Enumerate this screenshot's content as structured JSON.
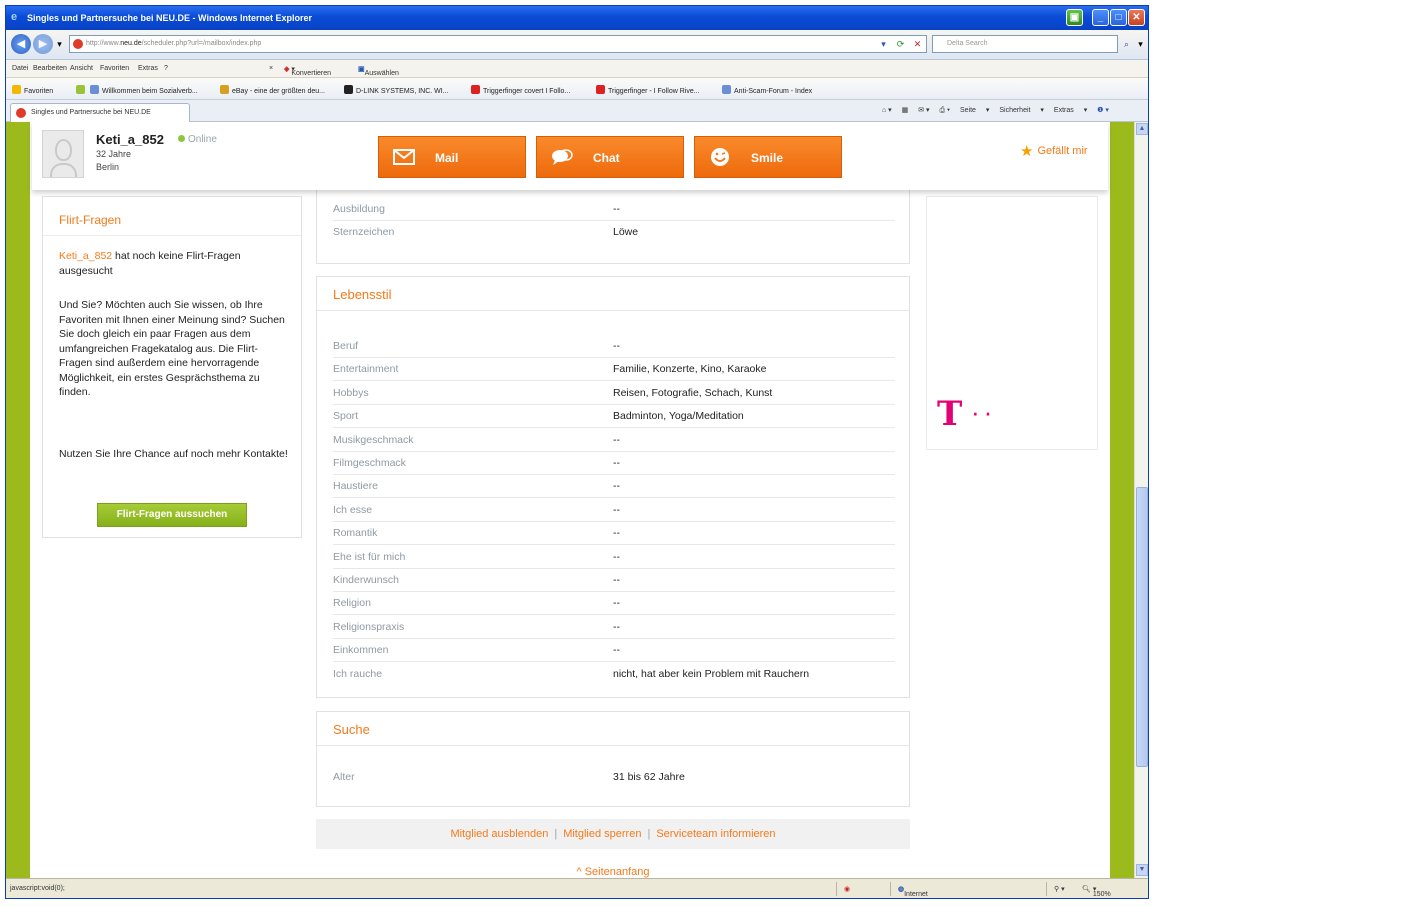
{
  "window": {
    "title": "Singles und Partnersuche bei NEU.DE - Windows Internet Explorer",
    "address_prefix": "http://www.",
    "address_host": "neu.de",
    "address_path": "/scheduler.php?url=/mailbox/index.php",
    "search_placeholder": "Delta Search",
    "status_text": "javascript:void(0);",
    "zone": "Internet",
    "zoom": "150%"
  },
  "menu": [
    "Datei",
    "Bearbeiten",
    "Ansicht",
    "Favoriten",
    "Extras",
    "?"
  ],
  "menu_extra": [
    "Konvertieren",
    "Auswählen"
  ],
  "favorites": {
    "label": "Favoriten",
    "items": [
      "Willkommen beim Sozialverb...",
      "eBay - eine der größten deu...",
      "D-LINK SYSTEMS, INC. WI...",
      "Triggerfinger covert I Follo...",
      "Triggerfinger - I Follow Rive...",
      "Anti-Scam-Forum - Index"
    ]
  },
  "tab": {
    "label": "Singles und Partnersuche bei NEU.DE"
  },
  "commands": [
    "Seite",
    "Sicherheit",
    "Extras"
  ],
  "profile": {
    "username": "Keti_a_852",
    "status": "Online",
    "age": "32 Jahre",
    "city": "Berlin",
    "mail_label": "Mail",
    "chat_label": "Chat",
    "smile_label": "Smile",
    "like_label": "Gefällt mir"
  },
  "flirt": {
    "title": "Flirt-Fragen",
    "p1_user": "Keti_a_852",
    "p1_rest": " hat noch keine Flirt-Fragen ausgesucht",
    "p2": "Und Sie? Möchten auch Sie wissen, ob Ihre Favoriten mit Ihnen einer Meinung sind? Suchen Sie doch gleich ein paar Fragen aus dem umfangreichen Fragekatalog aus. Die Flirt-Fragen sind außerdem eine hervorragende Möglichkeit, ein erstes Gesprächsthema zu finden.",
    "p3": "Nutzen Sie Ihre Chance auf noch mehr Kontakte!",
    "button": "Flirt-Fragen aussuchen"
  },
  "basic": {
    "rows": [
      {
        "k": "Ausbildung",
        "v": "--"
      },
      {
        "k": "Sternzeichen",
        "v": "Löwe"
      }
    ]
  },
  "lifestyle": {
    "title": "Lebensstil",
    "rows": [
      {
        "k": "Beruf",
        "v": "--"
      },
      {
        "k": "Entertainment",
        "v": "Familie, Konzerte, Kino, Karaoke"
      },
      {
        "k": "Hobbys",
        "v": "Reisen, Fotografie, Schach, Kunst"
      },
      {
        "k": "Sport",
        "v": "Badminton, Yoga/Meditation"
      },
      {
        "k": "Musikgeschmack",
        "v": "--"
      },
      {
        "k": "Filmgeschmack",
        "v": "--"
      },
      {
        "k": "Haustiere",
        "v": "--"
      },
      {
        "k": "Ich esse",
        "v": "--"
      },
      {
        "k": "Romantik",
        "v": "--"
      },
      {
        "k": "Ehe ist für mich",
        "v": "--"
      },
      {
        "k": "Kinderwunsch",
        "v": "--"
      },
      {
        "k": "Religion",
        "v": "--"
      },
      {
        "k": "Religionspraxis",
        "v": "--"
      },
      {
        "k": "Einkommen",
        "v": "--"
      },
      {
        "k": "Ich rauche",
        "v": "nicht, hat aber kein Problem mit Rauchern"
      }
    ]
  },
  "search": {
    "title": "Suche",
    "rows": [
      {
        "k": "Alter",
        "v": "31 bis 62 Jahre"
      }
    ]
  },
  "footer": {
    "hide": "Mitglied ausblenden",
    "block": "Mitglied sperren",
    "report": "Serviceteam informieren",
    "top": "Seitenanfang"
  },
  "colors": {
    "accent_orange": "#f47a1a",
    "button_orange": "#f3781a",
    "green_frame": "#9dba1c",
    "telekom_magenta": "#e20074"
  }
}
